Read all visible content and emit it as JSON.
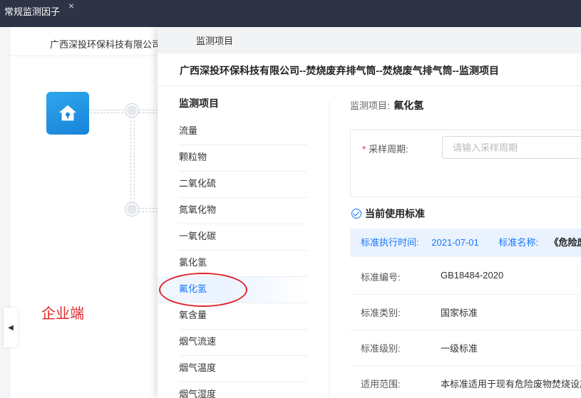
{
  "window": {
    "tab_title": "常规监测因子",
    "tab_close": "×"
  },
  "background": {
    "company": "广西深投环保科技有限公司",
    "enterprise_label": "企业端"
  },
  "drawer": {
    "header_title": "监测项目",
    "path_title": "广西深投环保科技有限公司--焚烧废弃排气筒--焚烧废气排气筒--监测项目",
    "list_title": "监测项目",
    "items": [
      {
        "label": "流量"
      },
      {
        "label": "颗粒物"
      },
      {
        "label": "二氧化硫"
      },
      {
        "label": "氮氧化物"
      },
      {
        "label": "一氧化碳"
      },
      {
        "label": "氯化氢"
      },
      {
        "label": "氟化氢"
      },
      {
        "label": "氧含量"
      },
      {
        "label": "烟气流速"
      },
      {
        "label": "烟气温度"
      },
      {
        "label": "烟气湿度"
      }
    ],
    "active_index": 6
  },
  "detail": {
    "item_label": "监测项目:",
    "item_value": "氟化氢",
    "form": {
      "period_label": "采样周期:",
      "period_required_mark": "*",
      "period_placeholder": "请输入采样周期",
      "period_value": ""
    },
    "standard_heading": "当前使用标准",
    "standard_bar": {
      "time_label": "标准执行时间:",
      "time_value": "2021-07-01",
      "name_label": "标准名称:",
      "name_value": "《危险废物"
    },
    "rows": [
      {
        "key": "标准编号:",
        "value": "GB18484-2020"
      },
      {
        "key": "标准类别:",
        "value": "国家标准"
      },
      {
        "key": "标准级别:",
        "value": "一级标准"
      },
      {
        "key": "适用范围:",
        "value": "本标准适用于现有危险废物焚烧设施"
      }
    ]
  },
  "colors": {
    "accent": "#1677ff",
    "annotation": "#e0252b",
    "topbar": "#2e3346"
  }
}
